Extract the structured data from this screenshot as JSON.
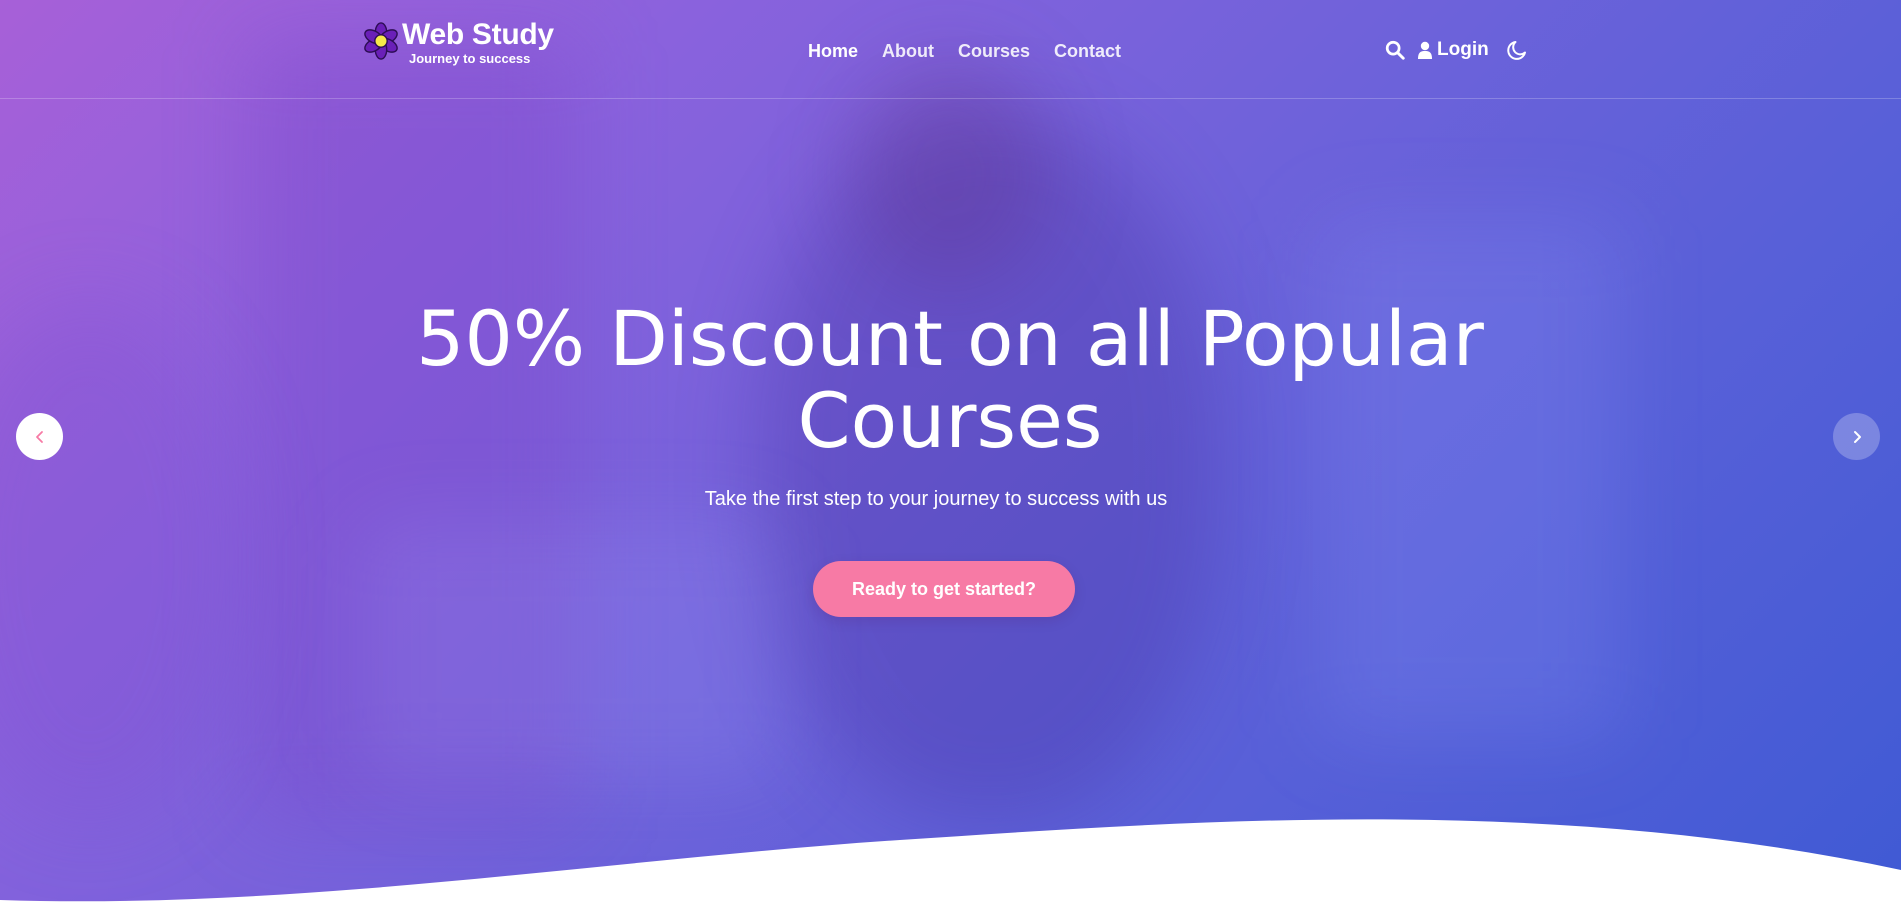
{
  "brand": {
    "name": "Web Study",
    "tagline": "Journey to success"
  },
  "nav": {
    "links": [
      {
        "label": "Home",
        "active": true
      },
      {
        "label": "About",
        "active": false
      },
      {
        "label": "Courses",
        "active": false
      },
      {
        "label": "Contact",
        "active": false
      }
    ],
    "login_label": "Login"
  },
  "hero": {
    "title": "50% Discount on all Popular Courses",
    "subtitle": "Take the first step to your journey to success with us",
    "cta_label": "Ready to get started?"
  },
  "icons": {
    "logo": "flower-icon",
    "search": "search-icon",
    "user": "user-icon",
    "theme": "moon-icon",
    "prev": "chevron-left-icon",
    "next": "chevron-right-icon"
  },
  "colors": {
    "gradient_start": "#a760d8",
    "gradient_end": "#3f5ad4",
    "cta": "#f77aa5",
    "logo_petals": "#6a1fb8",
    "logo_center": "#f6e84a"
  }
}
